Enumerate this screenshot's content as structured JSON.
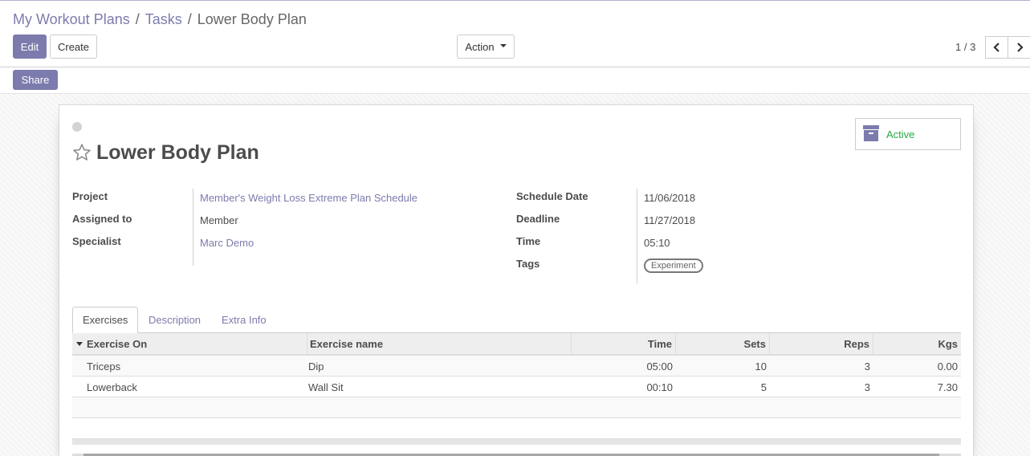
{
  "breadcrumb": {
    "items": [
      "My Workout Plans",
      "Tasks"
    ],
    "separator": "/",
    "current": "Lower Body Plan"
  },
  "toolbar": {
    "edit_label": "Edit",
    "create_label": "Create",
    "action_label": "Action",
    "share_label": "Share"
  },
  "pager": {
    "value": "1 / 3"
  },
  "record": {
    "title": "Lower Body Plan",
    "active_label": "Active",
    "fields_left": [
      {
        "label": "Project",
        "value": "Member's Weight Loss Extreme Plan Schedule"
      },
      {
        "label": "Assigned to",
        "value": "Member"
      },
      {
        "label": "Specialist",
        "value": "Marc Demo"
      }
    ],
    "fields_right": [
      {
        "label": "Schedule Date",
        "value": "11/06/2018"
      },
      {
        "label": "Deadline",
        "value": "11/27/2018"
      },
      {
        "label": "Time",
        "value": "05:10"
      },
      {
        "label": "Tags",
        "value": "Experiment"
      }
    ]
  },
  "tabs": [
    "Exercises",
    "Description",
    "Extra Info"
  ],
  "table": {
    "columns": [
      "Exercise On",
      "Exercise name",
      "Time",
      "Sets",
      "Reps",
      "Kgs"
    ],
    "rows": [
      [
        "Triceps",
        "Dip",
        "05:00",
        "10",
        "3",
        "0.00"
      ],
      [
        "Lowerback",
        "Wall Sit",
        "00:10",
        "5",
        "3",
        "7.30"
      ]
    ]
  },
  "colors": {
    "primary": "#7c7bad",
    "active_green": "#28a745",
    "text": "#4c4c4c"
  }
}
